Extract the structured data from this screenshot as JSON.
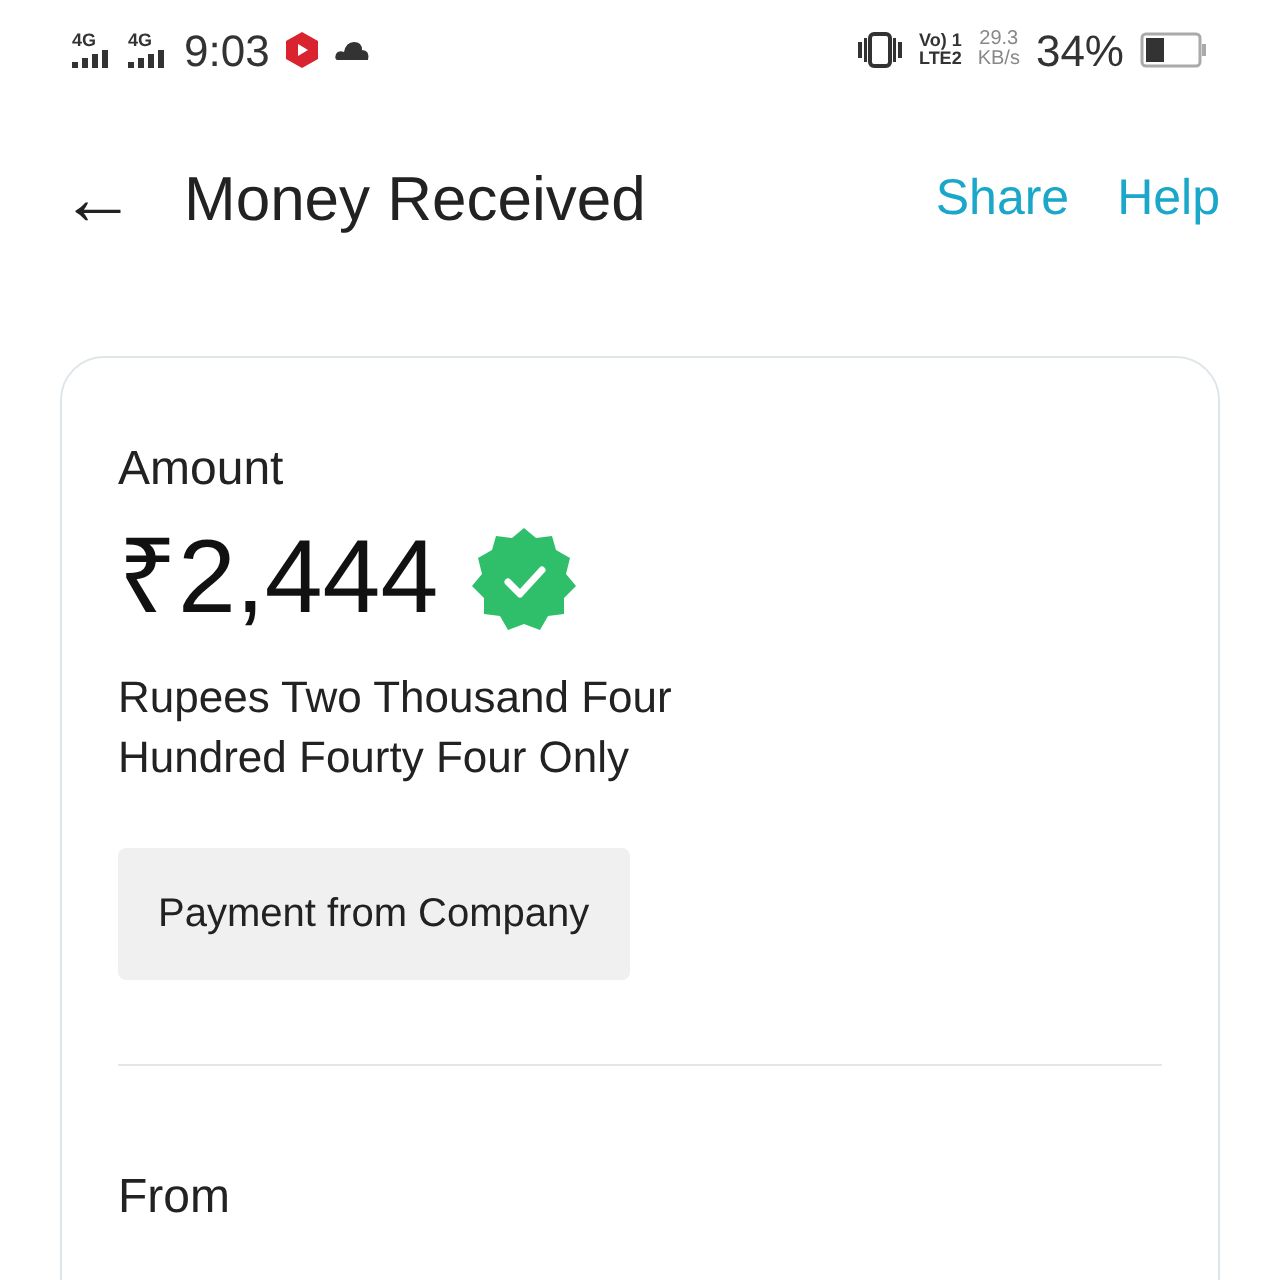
{
  "status_bar": {
    "network_1": "4G",
    "network_2": "4G",
    "time": "9:03",
    "volte": "Vo) 1",
    "lte": "LTE2",
    "speed_value": "29.3",
    "speed_unit": "KB/s",
    "battery": "34%"
  },
  "header": {
    "back": "←",
    "title": "Money Received",
    "actions": [
      "Share",
      "Help"
    ]
  },
  "card": {
    "amount_label": "Amount",
    "amount": "₹2,444",
    "verified": true,
    "amount_words": "Rupees Two Thousand Four Hundred Fourty Four Only",
    "note": "Payment from Company",
    "from_label": "From"
  }
}
